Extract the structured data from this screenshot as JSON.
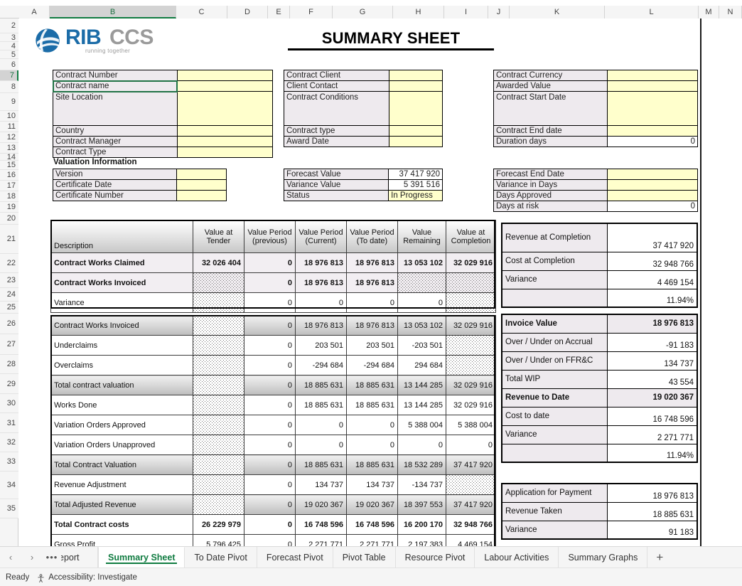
{
  "app": {
    "title": "SUMMARY SHEET",
    "logo": {
      "brand_primary": "RIB",
      "brand_secondary": "CCS",
      "tagline": "running together",
      "color_primary": "#1b6ca8",
      "color_secondary": "#9a9a9a"
    }
  },
  "grid": {
    "columns": [
      "A",
      "B",
      "C",
      "D",
      "E",
      "F",
      "G",
      "H",
      "I",
      "J",
      "K",
      "L",
      "M",
      "N"
    ],
    "selected_column": "B",
    "rows": [
      "2",
      "3",
      "4",
      "5",
      "6",
      "7",
      "8",
      "9",
      "10",
      "11",
      "12",
      "13",
      "14",
      "15",
      "16",
      "17",
      "18",
      "19",
      "20",
      "21",
      "22",
      "23",
      "24",
      "25",
      "26",
      "27",
      "28",
      "29",
      "30",
      "31",
      "32",
      "33",
      "34",
      "35"
    ],
    "selected_row": "7"
  },
  "contract_info": {
    "left": [
      {
        "label": "Contract Number",
        "value": ""
      },
      {
        "label": "Contract name",
        "value": ""
      },
      {
        "label": "Site Location",
        "value": ""
      },
      {
        "label": "Country",
        "value": ""
      },
      {
        "label": "Contract Manager",
        "value": ""
      },
      {
        "label": "Contract Type",
        "value": ""
      }
    ],
    "middle": [
      {
        "label": "Contract Client",
        "value": ""
      },
      {
        "label": "Client Contact",
        "value": ""
      },
      {
        "label": "Contract Conditions",
        "value": ""
      },
      {
        "label": "Contract type",
        "value": ""
      },
      {
        "label": "Award Date",
        "value": ""
      }
    ],
    "right": [
      {
        "label": "Contract Currency",
        "value": ""
      },
      {
        "label": "Awarded Value",
        "value": ""
      },
      {
        "label": "Contract Start Date",
        "value": ""
      },
      {
        "label": "Contract End date",
        "value": ""
      },
      {
        "label": "Duration days",
        "value": "0"
      }
    ]
  },
  "valuation": {
    "section_title": "Valuation Information",
    "left": [
      {
        "label": "Version",
        "value": ""
      },
      {
        "label": "Certificate Date",
        "value": ""
      },
      {
        "label": "Certificate Number",
        "value": ""
      }
    ],
    "middle": [
      {
        "label": "Forecast Value",
        "value": "37 417 920"
      },
      {
        "label": "Variance Value",
        "value": "5 391 516"
      },
      {
        "label": "Status",
        "value": "In Progress"
      }
    ],
    "right": [
      {
        "label": "Forecast End Date",
        "value": ""
      },
      {
        "label": "Variance in Days",
        "value": ""
      },
      {
        "label": "Days Approved",
        "value": ""
      },
      {
        "label": "Days at risk",
        "value": "0"
      }
    ]
  },
  "main_table": {
    "headers": [
      "Description",
      "Value at Tender",
      "Value Period (previous)",
      "Value Period (Current)",
      "Value Period (To date)",
      "Value Remaining",
      "Value at Completion"
    ],
    "headers_l1": [
      "Description",
      "Value at",
      "Value Period",
      "Value Period",
      "Value Period",
      "Value",
      "Value at"
    ],
    "headers_l2": [
      "",
      "Tender",
      "(previous)",
      "(Current)",
      "(To date)",
      "Remaining",
      "Completion"
    ],
    "block1": [
      {
        "desc": "Contract Works Claimed",
        "cells": [
          "32 026 404",
          "0",
          "18 976 813",
          "18 976 813",
          "13 053 102",
          "32 029 916"
        ]
      },
      {
        "desc": "Contract Works Invoiced",
        "cells": [
          "",
          "0",
          "18 976 813",
          "18 976 813",
          "",
          ""
        ]
      },
      {
        "desc": "Variance",
        "cells": [
          "",
          "0",
          "0",
          "0",
          "0",
          ""
        ]
      }
    ],
    "block2": [
      {
        "desc": "Contract Works Invoiced",
        "cells": [
          "",
          "0",
          "18 976 813",
          "18 976 813",
          "13 053 102",
          "32 029 916"
        ]
      },
      {
        "desc": "Underclaims",
        "cells": [
          "",
          "0",
          "203 501",
          "203 501",
          "-203 501",
          ""
        ]
      },
      {
        "desc": "Overclaims",
        "cells": [
          "",
          "0",
          "-294 684",
          "-294 684",
          "294 684",
          ""
        ]
      },
      {
        "desc": "Total contract valuation",
        "cells": [
          "",
          "0",
          "18 885 631",
          "18 885 631",
          "13 144 285",
          "32 029 916"
        ]
      },
      {
        "desc": "Works Done",
        "cells": [
          "",
          "0",
          "18 885 631",
          "18 885 631",
          "13 144 285",
          "32 029 916"
        ]
      },
      {
        "desc": "Variation Orders Approved",
        "cells": [
          "",
          "0",
          "0",
          "0",
          "5 388 004",
          "5 388 004"
        ]
      },
      {
        "desc": "Variation Orders Unapproved",
        "cells": [
          "",
          "0",
          "0",
          "0",
          "0",
          "0"
        ]
      },
      {
        "desc": "Total Contract Valuation",
        "cells": [
          "",
          "0",
          "18 885 631",
          "18 885 631",
          "18 532 289",
          "37 417 920"
        ]
      },
      {
        "desc": "Revenue Adjustment",
        "cells": [
          "",
          "0",
          "134 737",
          "134 737",
          "-134 737",
          ""
        ]
      },
      {
        "desc": "Total Adjusted Revenue",
        "cells": [
          "",
          "0",
          "19 020 367",
          "19 020 367",
          "18 397 553",
          "37 417 920"
        ]
      },
      {
        "desc": "Total Contract costs",
        "cells": [
          "26 229 979",
          "0",
          "16 748 596",
          "16 748 596",
          "16 200 170",
          "32 948 766"
        ]
      },
      {
        "desc": "Gross Profit",
        "cells": [
          "5 796 425",
          "0",
          "2 271 771",
          "2 271 771",
          "2 197 383",
          "4 469 154"
        ]
      }
    ]
  },
  "panel_completion": [
    {
      "label": "Revenue at Completion",
      "value": "37 417 920"
    },
    {
      "label": "Cost at Completion",
      "value": "32 948 766"
    },
    {
      "label": "Variance",
      "value": "4 469 154"
    },
    {
      "label": "",
      "value": "11.94%"
    }
  ],
  "panel_todate": [
    {
      "label": "Invoice Value",
      "value": "18 976 813"
    },
    {
      "label": "Over / Under on Accrual",
      "value": "-91 183"
    },
    {
      "label": "Over / Under on FFR&C",
      "value": "134 737"
    },
    {
      "label": "Total WIP",
      "value": "43 554"
    },
    {
      "label": "Revenue to Date",
      "value": "19 020 367"
    },
    {
      "label": "Cost to date",
      "value": "16 748 596"
    },
    {
      "label": "Variance",
      "value": "2 271 771"
    },
    {
      "label": "",
      "value": "11.94%"
    }
  ],
  "panel_payment": [
    {
      "label": "Application for Payment",
      "value": "18 976 813"
    },
    {
      "label": "Revenue Taken",
      "value": "18 885 631"
    },
    {
      "label": "Variance",
      "value": "91 183"
    }
  ],
  "tabs": {
    "prev_label": "‹",
    "next_label": "›",
    "overflow_label": "•••",
    "items": [
      {
        "label": "Report",
        "active": false,
        "clipped": true
      },
      {
        "label": "Summary Sheet",
        "active": true,
        "clipped": false
      },
      {
        "label": "To Date Pivot",
        "active": false,
        "clipped": false
      },
      {
        "label": "Forecast Pivot",
        "active": false,
        "clipped": false
      },
      {
        "label": "Pivot Table",
        "active": false,
        "clipped": false
      },
      {
        "label": "Resource Pivot",
        "active": false,
        "clipped": false
      },
      {
        "label": "Labour Activities",
        "active": false,
        "clipped": false
      },
      {
        "label": "Summary Graphs",
        "active": false,
        "clipped": false
      }
    ],
    "add_sheet_label": "+"
  },
  "status_bar": {
    "state": "Ready",
    "accessibility": "Accessibility: Investigate"
  }
}
